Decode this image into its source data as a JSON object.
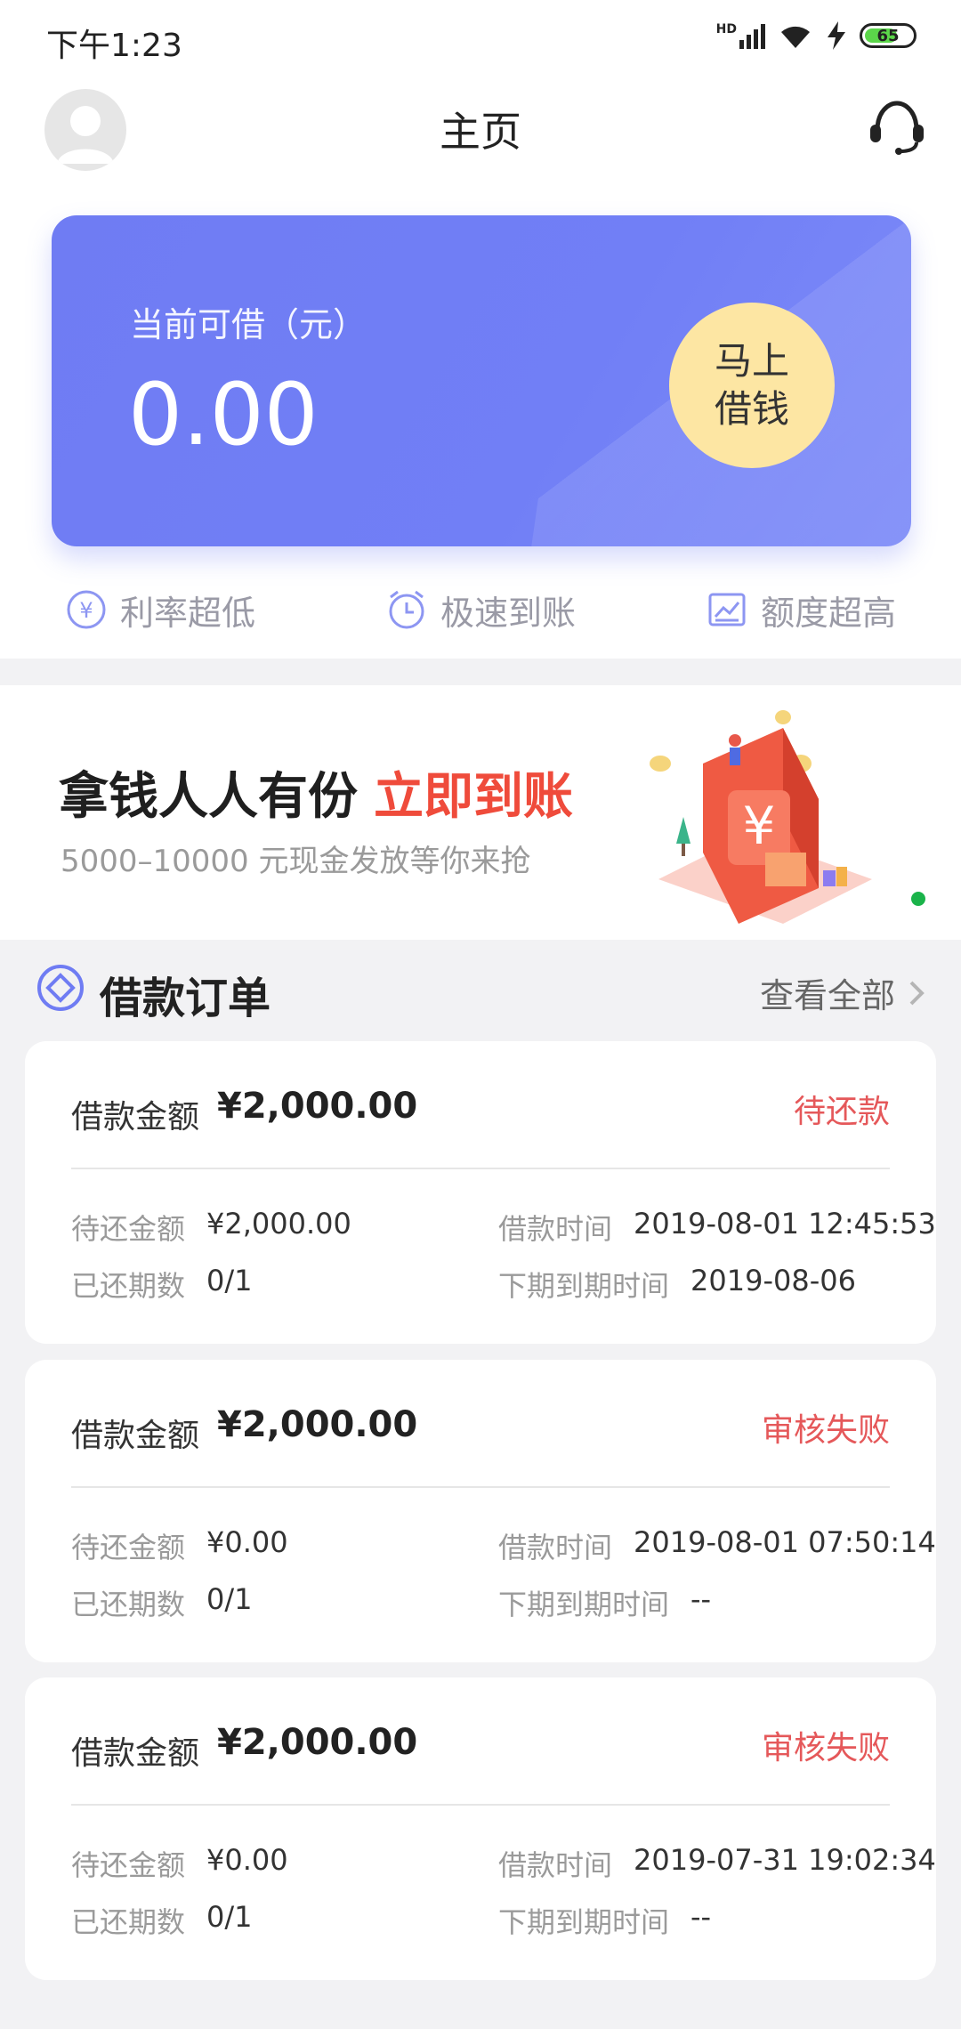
{
  "status_bar": {
    "time": "下午1:23",
    "network": "HD",
    "battery": "65"
  },
  "header": {
    "title": "主页"
  },
  "loan_card": {
    "label": "当前可借（元）",
    "amount": "0.00",
    "button_line1": "马上",
    "button_line2": "借钱"
  },
  "features": [
    {
      "label": "利率超低",
      "icon": "yuan-icon"
    },
    {
      "label": "极速到账",
      "icon": "clock-icon"
    },
    {
      "label": "额度超高",
      "icon": "chart-icon"
    }
  ],
  "banner": {
    "headline": "拿钱人人有份",
    "headline_highlight": "立即到账",
    "subtitle": "5000–10000 元现金发放等你来抢"
  },
  "orders": {
    "title": "借款订单",
    "view_all": "查看全部",
    "amount_label": "借款金额",
    "pending_label": "待还金额",
    "paid_periods_label": "已还期数",
    "loan_time_label": "借款时间",
    "next_due_label": "下期到期时间",
    "items": [
      {
        "amount": "¥2,000.00",
        "status": "待还款",
        "pending": "¥2,000.00",
        "paid_periods": "0/1",
        "loan_time": "2019-08-01 12:45:53",
        "next_due": "2019-08-06"
      },
      {
        "amount": "¥2,000.00",
        "status": "审核失败",
        "pending": "¥0.00",
        "paid_periods": "0/1",
        "loan_time": "2019-08-01 07:50:14",
        "next_due": "--"
      },
      {
        "amount": "¥2,000.00",
        "status": "审核失败",
        "pending": "¥0.00",
        "paid_periods": "0/1",
        "loan_time": "2019-07-31 19:02:34",
        "next_due": "--"
      }
    ]
  },
  "colors": {
    "accent": "#717ff6",
    "button": "#fde6a3",
    "status": "#e5585a",
    "highlight": "#ef4b3b"
  }
}
